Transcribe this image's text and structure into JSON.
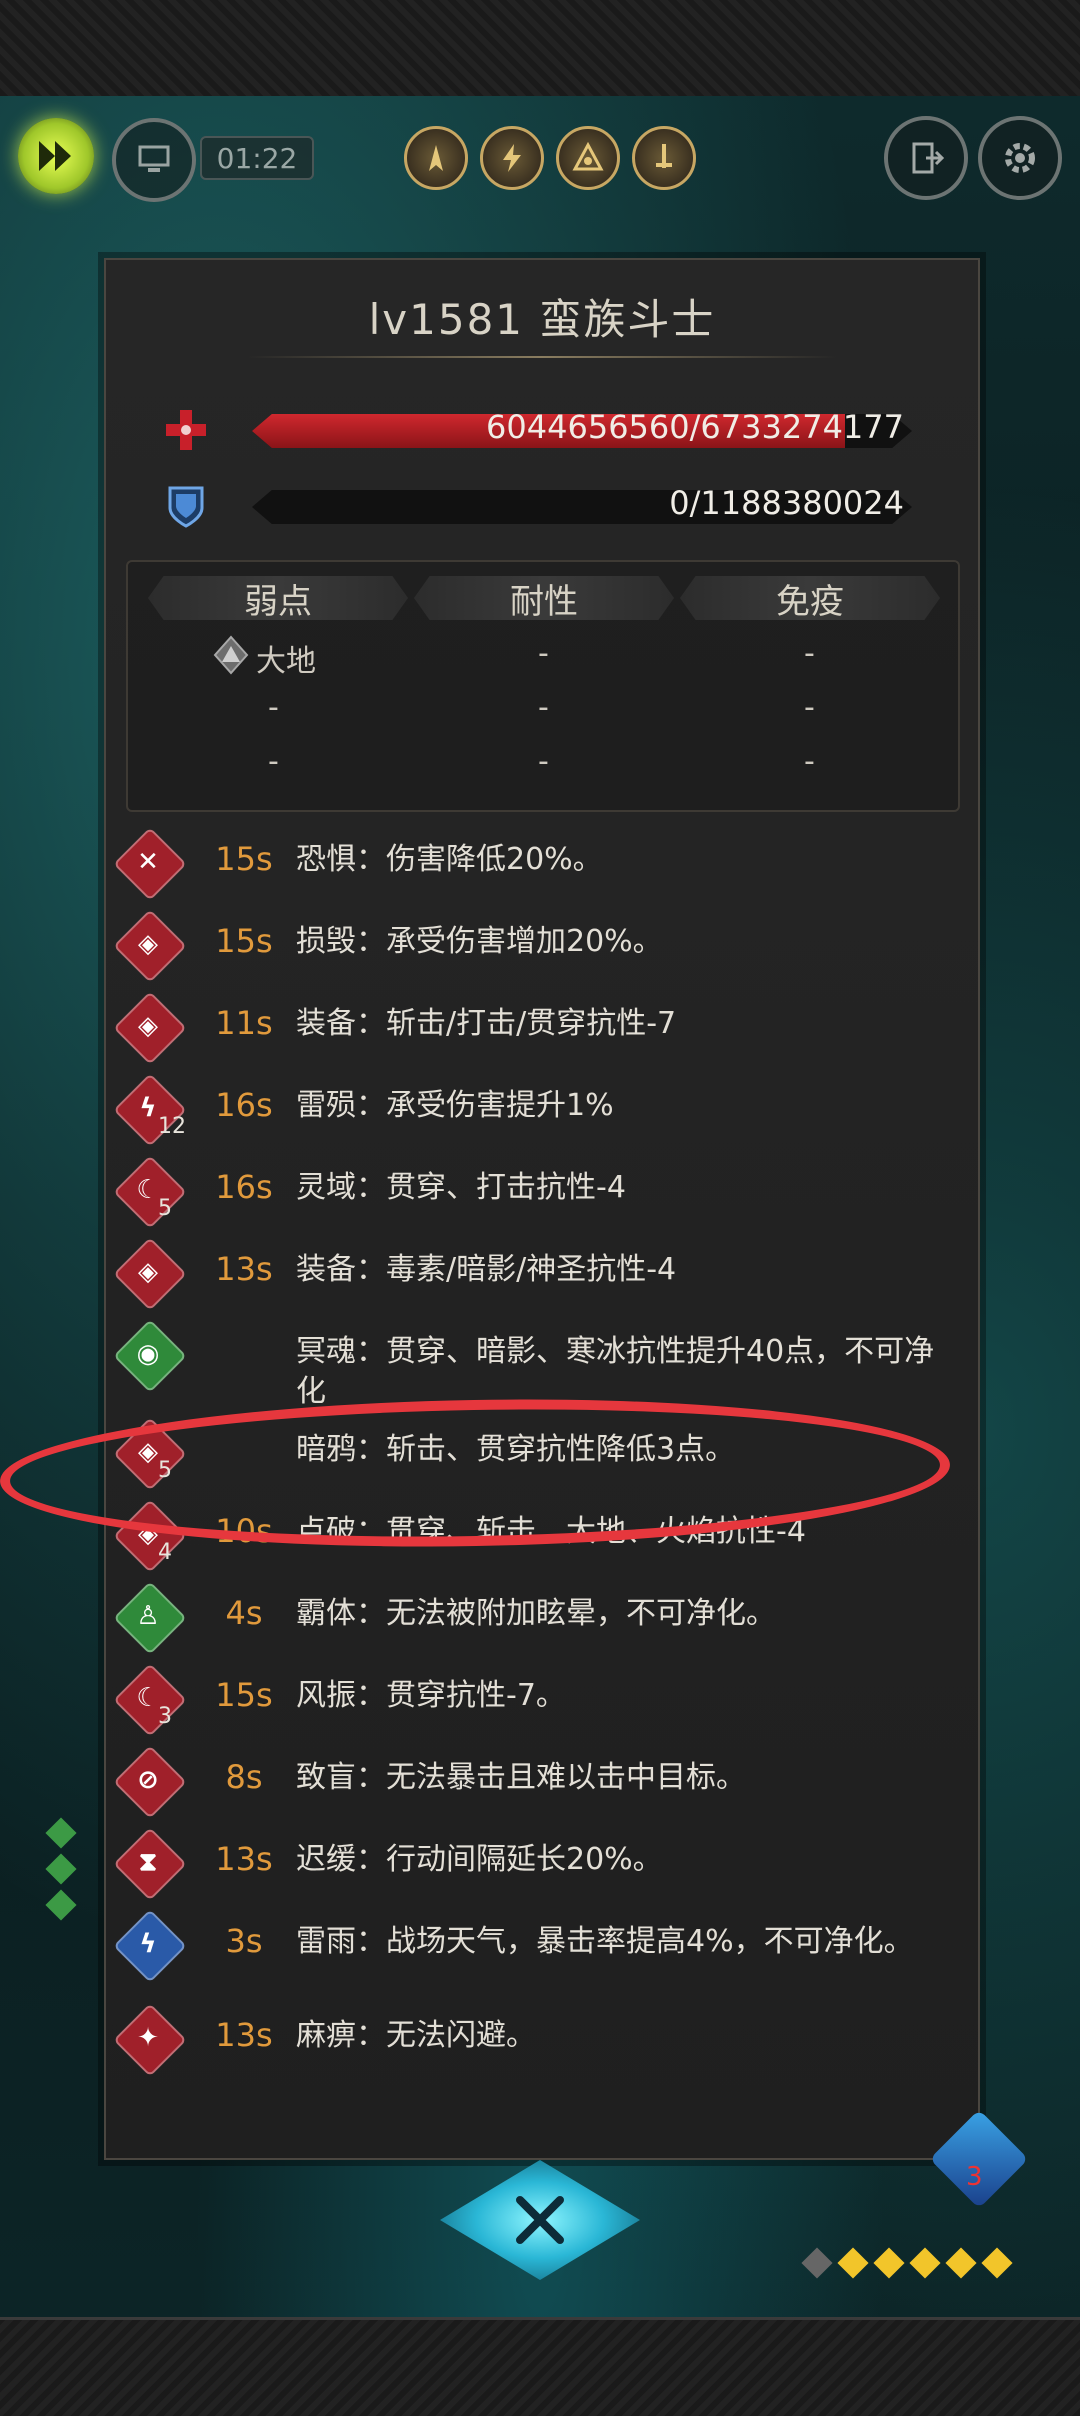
{
  "hud": {
    "timer": "01:22"
  },
  "monster": {
    "title": "lv1581 蛮族斗士",
    "hp_text": "6044656560/6733274177",
    "hp_fraction": 0.898,
    "shield_text": "0/1188380024",
    "shield_fraction": 0
  },
  "resistance": {
    "headers": [
      "弱点",
      "耐性",
      "免疫"
    ],
    "rows": [
      [
        "大地",
        "-",
        "-"
      ],
      [
        "-",
        "-",
        "-"
      ],
      [
        "-",
        "-",
        "-"
      ]
    ]
  },
  "effects": [
    {
      "icon": "fear-icon",
      "color": "#a0202a",
      "duration": "15s",
      "stack": "",
      "text": "恐惧：伤害降低20%。"
    },
    {
      "icon": "shield-break-icon",
      "color": "#a0202a",
      "duration": "15s",
      "stack": "",
      "text": "损毁：承受伤害增加20%。"
    },
    {
      "icon": "shield-break-icon",
      "color": "#a0202a",
      "duration": "11s",
      "stack": "",
      "text": "装备：斩击/打击/贯穿抗性-7"
    },
    {
      "icon": "lightning-icon",
      "color": "#a0202a",
      "duration": "16s",
      "stack": "12",
      "text": "雷殒：承受伤害提升1%"
    },
    {
      "icon": "claw-icon",
      "color": "#a0202a",
      "duration": "16s",
      "stack": "5",
      "text": "灵域：贯穿、打击抗性-4"
    },
    {
      "icon": "shield-break-icon",
      "color": "#a0202a",
      "duration": "13s",
      "stack": "",
      "text": "装备：毒素/暗影/神圣抗性-4"
    },
    {
      "icon": "eye-icon",
      "color": "#2f8a3a",
      "duration": "",
      "stack": "",
      "text": "冥魂：贯穿、暗影、寒冰抗性提升40点，不可净化"
    },
    {
      "icon": "shield-break-icon",
      "color": "#a0202a",
      "duration": "",
      "stack": "5",
      "text": "暗鸦：斩击、贯穿抗性降低3点。"
    },
    {
      "icon": "shield-break-icon",
      "color": "#a0202a",
      "duration": "10s",
      "stack": "4",
      "text": "点破：贯穿、斩击、大地、火焰抗性-4"
    },
    {
      "icon": "figure-icon",
      "color": "#2f8a3a",
      "duration": "4s",
      "stack": "",
      "text": "霸体：无法被附加眩晕，不可净化。"
    },
    {
      "icon": "claw-icon",
      "color": "#a0202a",
      "duration": "15s",
      "stack": "3",
      "text": "风振：贯穿抗性-7。"
    },
    {
      "icon": "blind-icon",
      "color": "#a0202a",
      "duration": "8s",
      "stack": "",
      "text": "致盲：无法暴击且难以击中目标。"
    },
    {
      "icon": "hourglass-icon",
      "color": "#a0202a",
      "duration": "13s",
      "stack": "",
      "text": "迟缓：行动间隔延长20%。"
    },
    {
      "icon": "thunderstorm-icon",
      "color": "#2a5aa8",
      "duration": "3s",
      "stack": "",
      "text": "雷雨：战场天气，暴击率提高4%，不可净化。"
    },
    {
      "icon": "paralysis-icon",
      "color": "#a0202a",
      "duration": "13s",
      "stack": "",
      "text": "麻痹：无法闪避。"
    }
  ],
  "corner_buff": {
    "count": "3"
  }
}
